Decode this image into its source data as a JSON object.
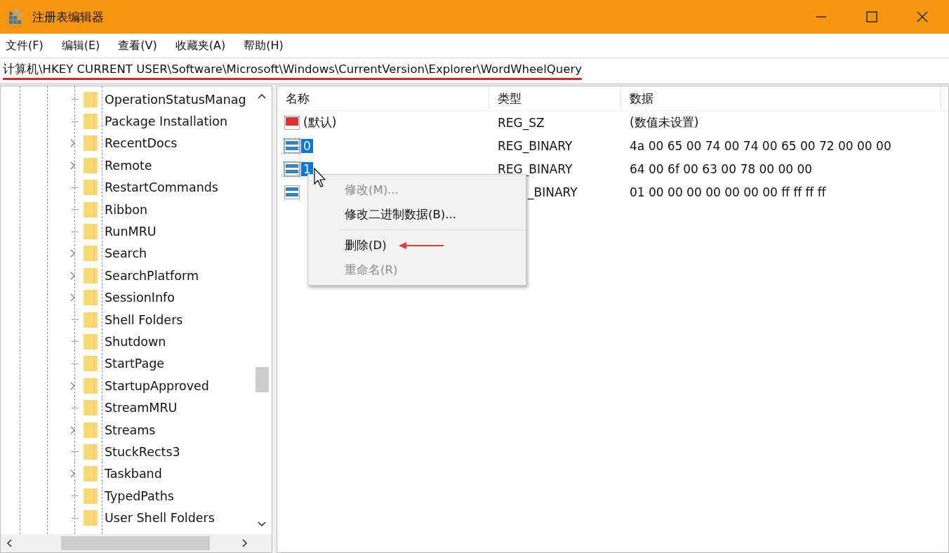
{
  "window": {
    "title": "注册表编辑器"
  },
  "menu": [
    "文件(F)",
    "编辑(E)",
    "查看(V)",
    "收藏夹(A)",
    "帮助(H)"
  ],
  "address": "计算机\\HKEY CURRENT USER\\Software\\Microsoft\\Windows\\CurrentVersion\\Explorer\\WordWheelQuery",
  "tree": [
    {
      "label": "OperationStatusManag",
      "expandable": false
    },
    {
      "label": "Package Installation",
      "expandable": false
    },
    {
      "label": "RecentDocs",
      "expandable": true
    },
    {
      "label": "Remote",
      "expandable": true
    },
    {
      "label": "RestartCommands",
      "expandable": false
    },
    {
      "label": "Ribbon",
      "expandable": false
    },
    {
      "label": "RunMRU",
      "expandable": false
    },
    {
      "label": "Search",
      "expandable": true
    },
    {
      "label": "SearchPlatform",
      "expandable": true
    },
    {
      "label": "SessionInfo",
      "expandable": true
    },
    {
      "label": "Shell Folders",
      "expandable": false
    },
    {
      "label": "Shutdown",
      "expandable": false
    },
    {
      "label": "StartPage",
      "expandable": false
    },
    {
      "label": "StartupApproved",
      "expandable": true
    },
    {
      "label": "StreamMRU",
      "expandable": false
    },
    {
      "label": "Streams",
      "expandable": true
    },
    {
      "label": "StuckRects3",
      "expandable": false
    },
    {
      "label": "Taskband",
      "expandable": true
    },
    {
      "label": "TypedPaths",
      "expandable": false
    },
    {
      "label": "User Shell Folders",
      "expandable": false
    }
  ],
  "table": {
    "columns": [
      "名称",
      "类型",
      "数据"
    ],
    "rows": [
      {
        "kind": "string",
        "name": "(默认)",
        "type": "REG_SZ",
        "data": "(数值未设置)",
        "selected": false,
        "obscured": false
      },
      {
        "kind": "binary",
        "name": "0",
        "type": "REG_BINARY",
        "data": "4a 00 65 00 74 00 74 00 65 00 72 00 00 00",
        "selected": true,
        "obscured": false
      },
      {
        "kind": "binary",
        "name": "1",
        "type": "REG_BINARY",
        "data": "64 00 6f 00 63 00 78 00 00 00",
        "selected": true,
        "obscured": false
      },
      {
        "kind": "binary",
        "type": "_BINARY",
        "data": "01 00 00 00 00 00 00 00 ff ff ff ff",
        "selected": false,
        "obscured": true
      }
    ]
  },
  "context_menu": [
    {
      "kind": "item",
      "label": "修改(M)...",
      "disabled": true
    },
    {
      "kind": "item",
      "label": "修改二进制数据(B)...",
      "disabled": false
    },
    {
      "kind": "separator"
    },
    {
      "kind": "item",
      "label": "删除(D)",
      "disabled": false,
      "annotated": true
    },
    {
      "kind": "item",
      "label": "重命名(R)",
      "disabled": true
    }
  ]
}
